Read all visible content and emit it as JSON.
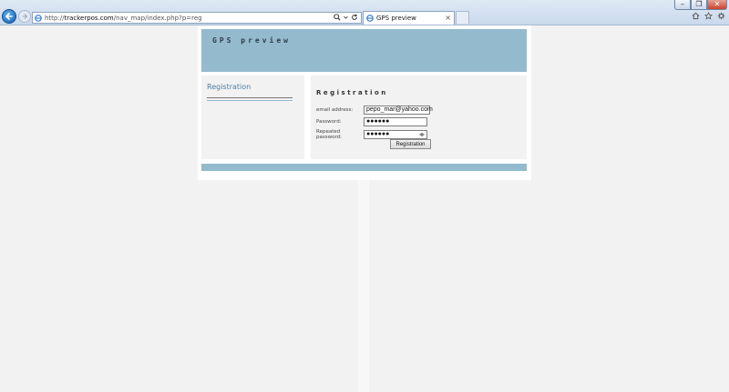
{
  "window": {
    "minimize_label": "–",
    "maximize_label": "❐",
    "close_label": "✕"
  },
  "browser": {
    "address_prefix": "http://",
    "address_host": "trackerpos.com",
    "address_path": "/nav_map/index.php?p=reg",
    "tab_title": "GPS preview",
    "tab_close": "×",
    "icons": [
      "back-icon",
      "forward-icon",
      "search-icon",
      "dropdown-icon",
      "refresh-icon",
      "home-icon",
      "favorites-icon",
      "gear-icon"
    ]
  },
  "site": {
    "title": "GPS preview"
  },
  "sidebar": {
    "link_label": "Registration"
  },
  "form": {
    "heading": "Registration",
    "email_label": "email address:",
    "email_value": "pepo_mar@yahoo.com",
    "password_label": "Password:",
    "password_value": "●●●●●●",
    "repeat_label": "Repeated password:",
    "repeat_value": "●●●●●●",
    "submit_label": "Registration"
  },
  "colors": {
    "header_bar": "#94bace",
    "link": "#4f7ea3",
    "panel": "#f2f2f2"
  }
}
